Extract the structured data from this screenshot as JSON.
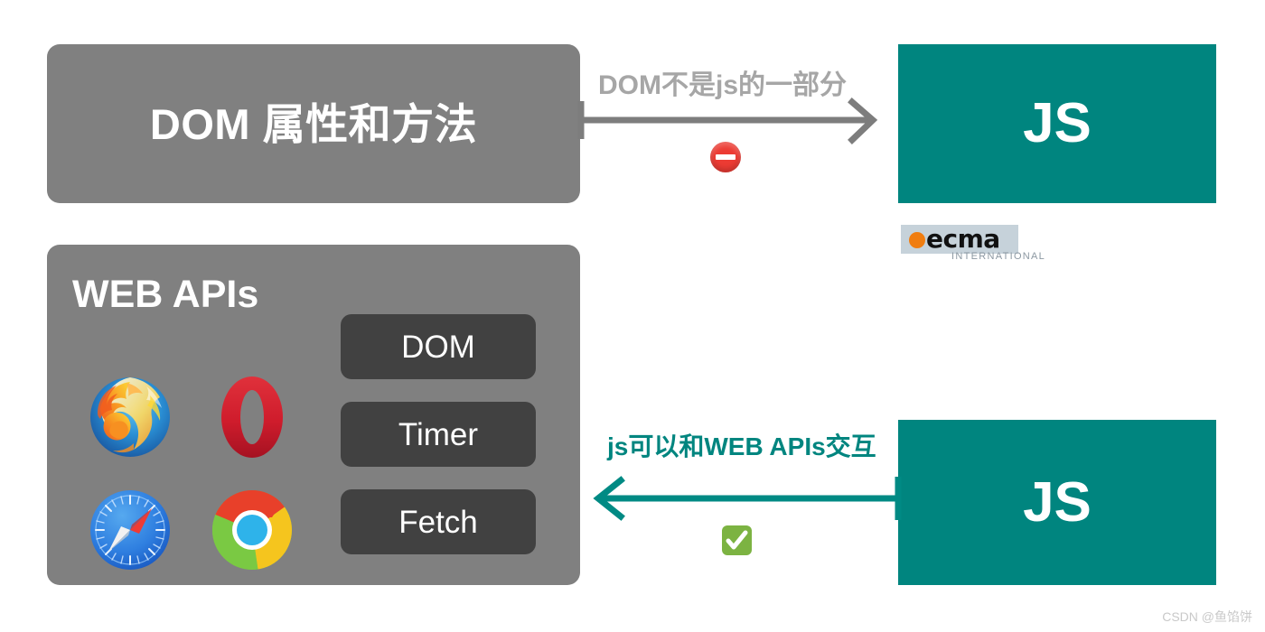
{
  "diagram": {
    "dom_properties_box": {
      "title": "DOM 属性和方法"
    },
    "webapis_box": {
      "title": "WEB APIs",
      "browsers": [
        {
          "name": "firefox",
          "label": "Firefox"
        },
        {
          "name": "opera",
          "label": "Opera"
        },
        {
          "name": "safari",
          "label": "Safari"
        },
        {
          "name": "chrome",
          "label": "Chrome"
        }
      ],
      "api_pills": [
        {
          "label": "DOM"
        },
        {
          "label": "Timer"
        },
        {
          "label": "Fetch"
        }
      ]
    },
    "js_box_top": {
      "label": "JS"
    },
    "js_box_bottom": {
      "label": "JS"
    },
    "ecma_logo": {
      "word": "ecma",
      "subtitle": "INTERNATIONAL"
    },
    "arrow_top": {
      "label": "DOM不是js的一部分",
      "direction": "right",
      "badge": "no-entry-sign"
    },
    "arrow_bottom": {
      "label": "js可以和WEB APIs交互",
      "direction": "left",
      "badge": "white-check-mark"
    },
    "watermark": "CSDN @鱼馅饼"
  },
  "colors": {
    "gray_panel": "#808080",
    "dark_pill": "#414141",
    "teal": "#00857f",
    "label_gray": "#a6a6a6",
    "no_entry_red": "#ec3b33",
    "check_green": "#7cb342",
    "ecma_orange": "#f07d10",
    "ecma_plate": "#c6d2da"
  }
}
